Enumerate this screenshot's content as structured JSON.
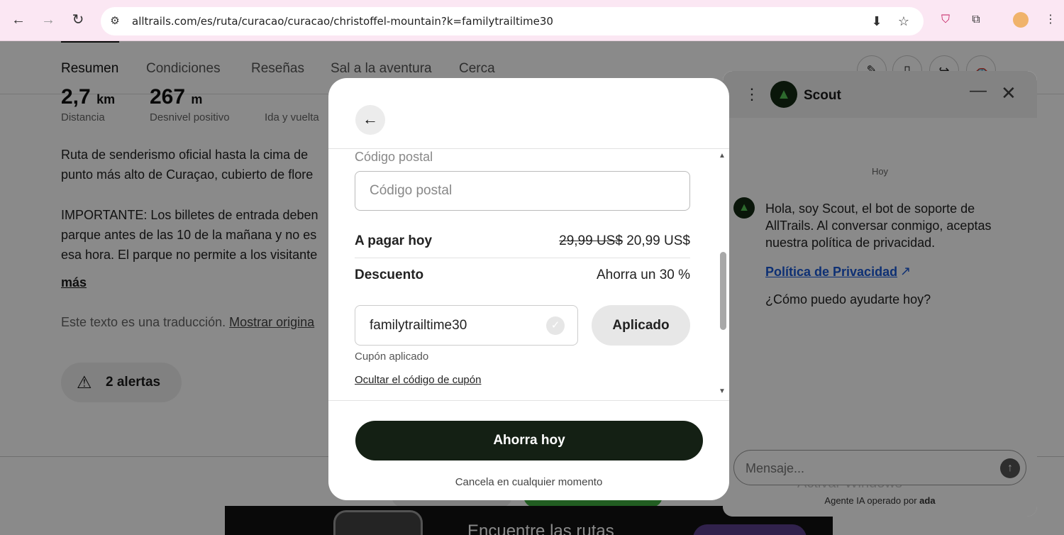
{
  "browser": {
    "url": "alltrails.com/es/ruta/curacao/curacao/christoffel-mountain?k=familytrailtime30"
  },
  "page": {
    "tabs": [
      "Resumen",
      "Condiciones",
      "Reseñas",
      "Sal a la aventura",
      "Cerca"
    ],
    "stats": [
      {
        "value": "2,7",
        "unit": "km",
        "label": "Distancia"
      },
      {
        "value": "267",
        "unit": "m",
        "label": "Desnivel positivo"
      },
      {
        "value": "",
        "unit": "",
        "label": "Ida y vuelta"
      }
    ],
    "description": [
      "Ruta de senderismo oficial hasta la cima de",
      "punto más alto de Curaçao, cubierto de flore"
    ],
    "important": [
      "IMPORTANTE: Los billetes de entrada deben",
      "parque antes de las 10 de la mañana y no es",
      "esa hora. El parque no permite a los visitante"
    ],
    "more_link": "más",
    "translation_note": "Este texto es una traducción.",
    "show_original": "Mostrar origina",
    "alerts_label": "2 alertas",
    "promo_text": "Encuentre las rutas"
  },
  "modal": {
    "postal_label": "Código postal",
    "postal_placeholder": "Código postal",
    "pay_today_label": "A pagar hoy",
    "price_old": "29,99 US$",
    "price_new": "20,99 US$",
    "discount_label": "Descuento",
    "discount_value": "Ahorra un 30 %",
    "coupon_code": "familytrailtime30",
    "applied_button": "Aplicado",
    "coupon_applied": "Cupón aplicado",
    "hide_coupon": "Ocultar el código de cupón",
    "cta": "Ahorra hoy",
    "cancel_note": "Cancela en cualquier momento"
  },
  "scout": {
    "title": "Scout",
    "day": "Hoy",
    "message": "Hola, soy Scout, el bot de soporte de AllTrails. Al conversar conmigo, aceptas nuestra política de privacidad.",
    "privacy_link": "Política de Privacidad",
    "question": "¿Cómo puedo ayudarte hoy?",
    "input_placeholder": "Mensaje...",
    "footer": "Agente IA operado por",
    "footer_brand": "ada",
    "watermark": "Activar Windows"
  }
}
